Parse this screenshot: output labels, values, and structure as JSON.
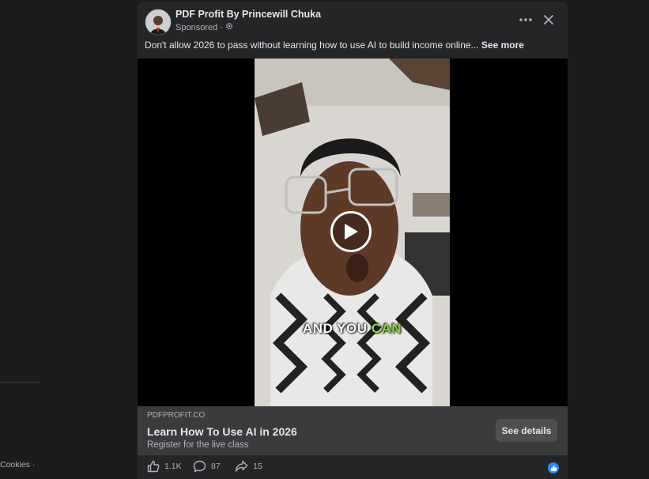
{
  "post": {
    "page_name": "PDF Profit By Princewill Chuka",
    "sponsored": "Sponsored ·",
    "caption": "Don't allow 2026 to pass without learning how to use AI to build income online...",
    "see_more": "See more"
  },
  "video": {
    "subtitle_white": "AND YOU ",
    "subtitle_highlight": "CAN"
  },
  "link": {
    "domain": "PDFPROFIT.CO",
    "title": "Learn How To Use AI in 2026",
    "description": "Register for the live class",
    "button": "See details"
  },
  "actions": {
    "likes": "1.1K",
    "comments": "87",
    "shares": "15"
  },
  "left_footer": {
    "cookies": "Cookies ·"
  },
  "icons": [
    "settings-icon",
    "more-options-icon",
    "close-icon",
    "play-icon",
    "like-icon",
    "comment-icon",
    "share-icon",
    "like-reaction-icon"
  ],
  "colors": {
    "accent": "#2d88ff",
    "subtitle_highlight": "#8fd93d",
    "card": "#242526",
    "background": "#1c1c1d"
  }
}
